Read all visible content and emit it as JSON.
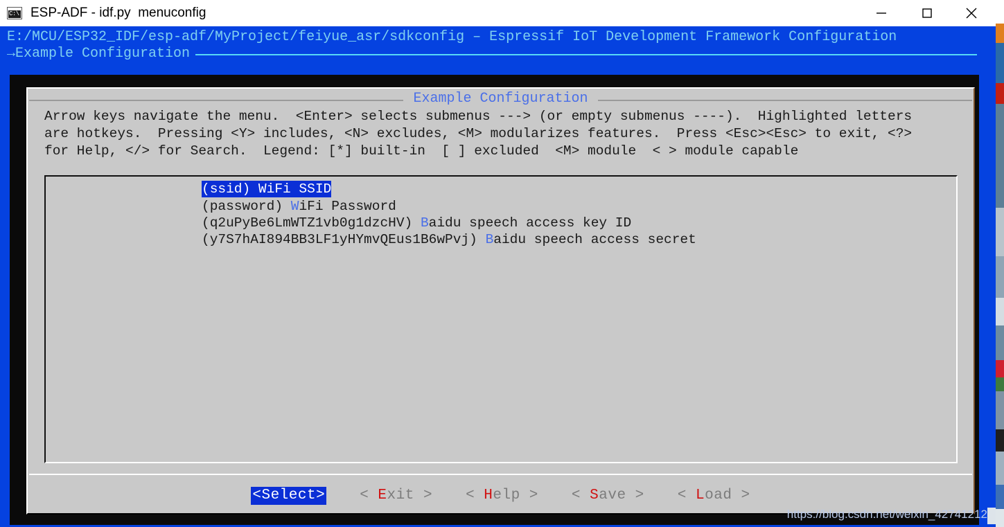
{
  "window": {
    "title": "ESP-ADF - idf.py  menuconfig",
    "icon": "console-icon",
    "controls": {
      "minimize": "minimize-icon",
      "maximize": "maximize-icon",
      "close": "close-icon"
    }
  },
  "console": {
    "path_line": "E:/MCU/ESP32_IDF/esp-adf/MyProject/feiyue_asr/sdkconfig – Espressif IoT Development Framework Configuration",
    "menu_path": "→Example Configuration"
  },
  "dialog": {
    "title": "Example Configuration",
    "help_text": "Arrow keys navigate the menu.  <Enter> selects submenus ---> (or empty submenus ----).  Highlighted letters\nare hotkeys.  Pressing <Y> includes, <N> excludes, <M> modularizes features.  Press <Esc><Esc> to exit, <?>\nfor Help, </> for Search.  Legend: [*] built-in  [ ] excluded  <M> module  < > module capable",
    "menu_items": [
      {
        "value": "(ssid)",
        "hotkey": "W",
        "label_rest": "iFi SSID",
        "selected": true
      },
      {
        "value": "(password)",
        "hotkey": "W",
        "label_rest": "iFi Password",
        "selected": false
      },
      {
        "value": "(q2uPyBe6LmWTZ1vb0g1dzcHV)",
        "hotkey": "B",
        "label_rest": "aidu speech access key ID",
        "selected": false
      },
      {
        "value": "(y7S7hAI894BB3LF1yHYmvQEus1B6wPvj)",
        "hotkey": "B",
        "label_rest": "aidu speech access secret",
        "selected": false
      }
    ],
    "buttons": [
      {
        "left": "<",
        "hotkey": "S",
        "rest": "elect",
        "right": ">",
        "active": true,
        "spaced": false
      },
      {
        "left": "<",
        "hotkey": "E",
        "rest": "xit",
        "right": ">",
        "active": false,
        "spaced": true
      },
      {
        "left": "<",
        "hotkey": "H",
        "rest": "elp",
        "right": ">",
        "active": false,
        "spaced": true
      },
      {
        "left": "<",
        "hotkey": "S",
        "rest": "ave",
        "right": ">",
        "active": false,
        "spaced": true
      },
      {
        "left": "<",
        "hotkey": "L",
        "rest": "oad",
        "right": ">",
        "active": false,
        "spaced": true
      }
    ]
  },
  "watermark": "https://blog.csdn.net/weixin_42741212",
  "colors": {
    "console_blue": "#0542e0",
    "console_text": "#7fd0f0",
    "dialog_bg": "#c9c9c9",
    "accent_blue": "#4a6fe8",
    "selection_blue": "#0b2fd6",
    "hotkey_red": "#d01010",
    "button_gray": "#7c7c7c"
  }
}
